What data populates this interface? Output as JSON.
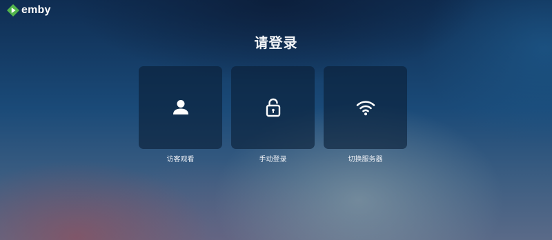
{
  "app": {
    "logo_text": "emby",
    "logo_icon": "emby-play-logo-icon",
    "brand_color": "#52b54b"
  },
  "login": {
    "title": "请登录",
    "options": [
      {
        "label": "访客观看",
        "icon": "user-icon"
      },
      {
        "label": "手动登录",
        "icon": "unlock-icon"
      },
      {
        "label": "切换服务器",
        "icon": "wifi-icon"
      }
    ]
  }
}
